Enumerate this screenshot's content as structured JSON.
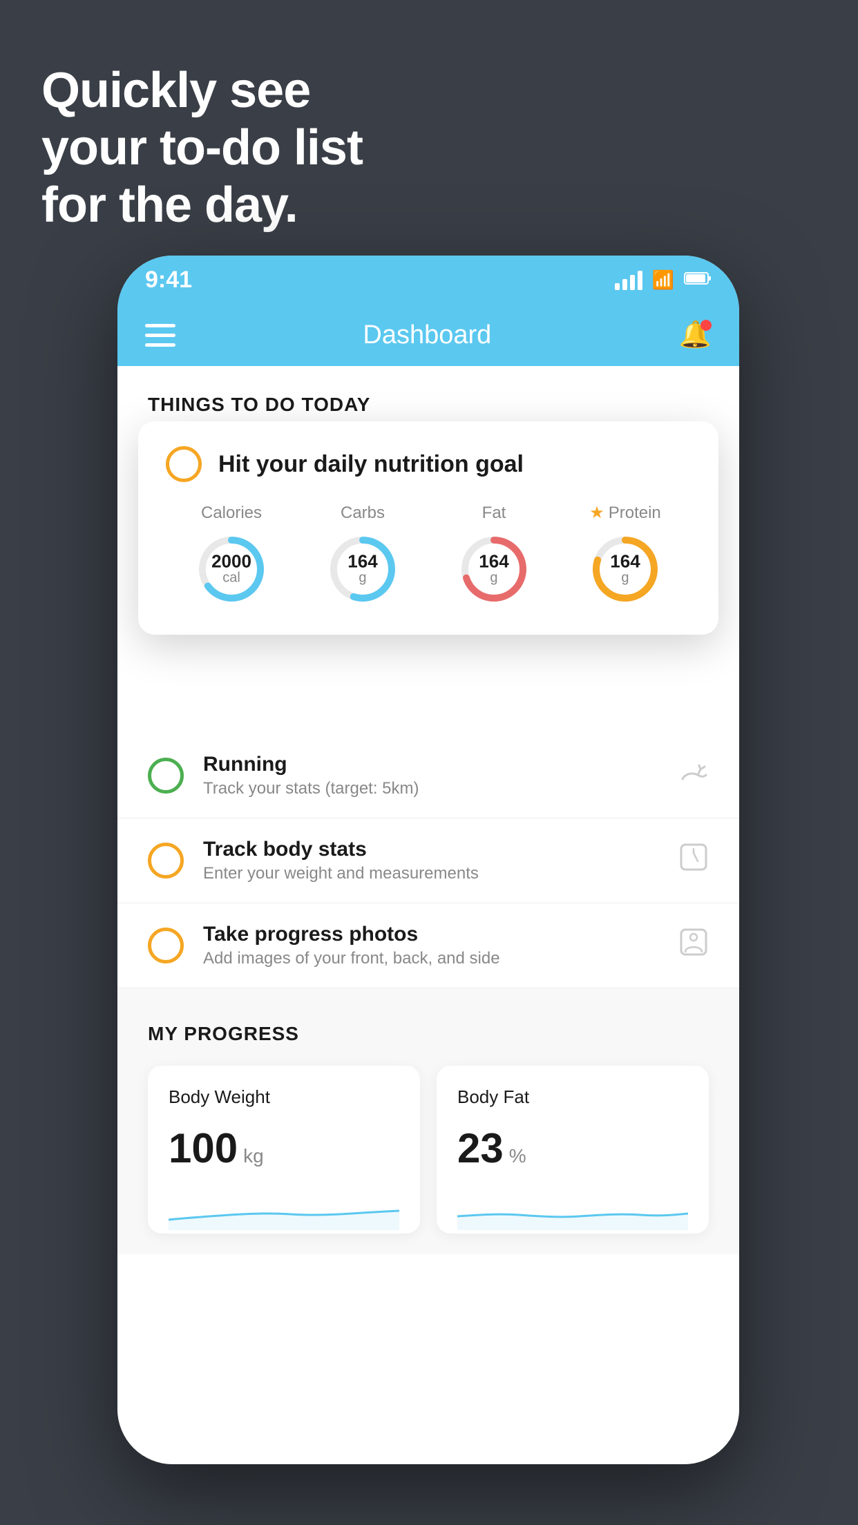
{
  "hero": {
    "line1": "Quickly see",
    "line2": "your to-do list",
    "line3": "for the day."
  },
  "status_bar": {
    "time": "9:41",
    "signal_alt": "signal bars",
    "wifi_alt": "wifi",
    "battery_alt": "battery"
  },
  "nav": {
    "title": "Dashboard",
    "menu_alt": "menu",
    "bell_alt": "notifications"
  },
  "things_today": {
    "section_label": "THINGS TO DO TODAY"
  },
  "nutrition_card": {
    "title": "Hit your daily nutrition goal",
    "stats": [
      {
        "label": "Calories",
        "value": "2000",
        "unit": "cal",
        "color": "#5bc8f0",
        "percent": 65
      },
      {
        "label": "Carbs",
        "value": "164",
        "unit": "g",
        "color": "#5bc8f0",
        "percent": 55
      },
      {
        "label": "Fat",
        "value": "164",
        "unit": "g",
        "color": "#e86b6b",
        "percent": 70
      },
      {
        "label": "Protein",
        "value": "164",
        "unit": "g",
        "color": "#f5a623",
        "percent": 80,
        "star": true
      }
    ]
  },
  "todo_items": [
    {
      "name": "Running",
      "sub": "Track your stats (target: 5km)",
      "circle_color": "green",
      "icon": "👟"
    },
    {
      "name": "Track body stats",
      "sub": "Enter your weight and measurements",
      "circle_color": "yellow",
      "icon": "⊡"
    },
    {
      "name": "Take progress photos",
      "sub": "Add images of your front, back, and side",
      "circle_color": "yellow",
      "icon": "👤"
    }
  ],
  "progress": {
    "section_label": "MY PROGRESS",
    "cards": [
      {
        "title": "Body Weight",
        "value": "100",
        "unit": "kg"
      },
      {
        "title": "Body Fat",
        "value": "23",
        "unit": "%"
      }
    ]
  }
}
